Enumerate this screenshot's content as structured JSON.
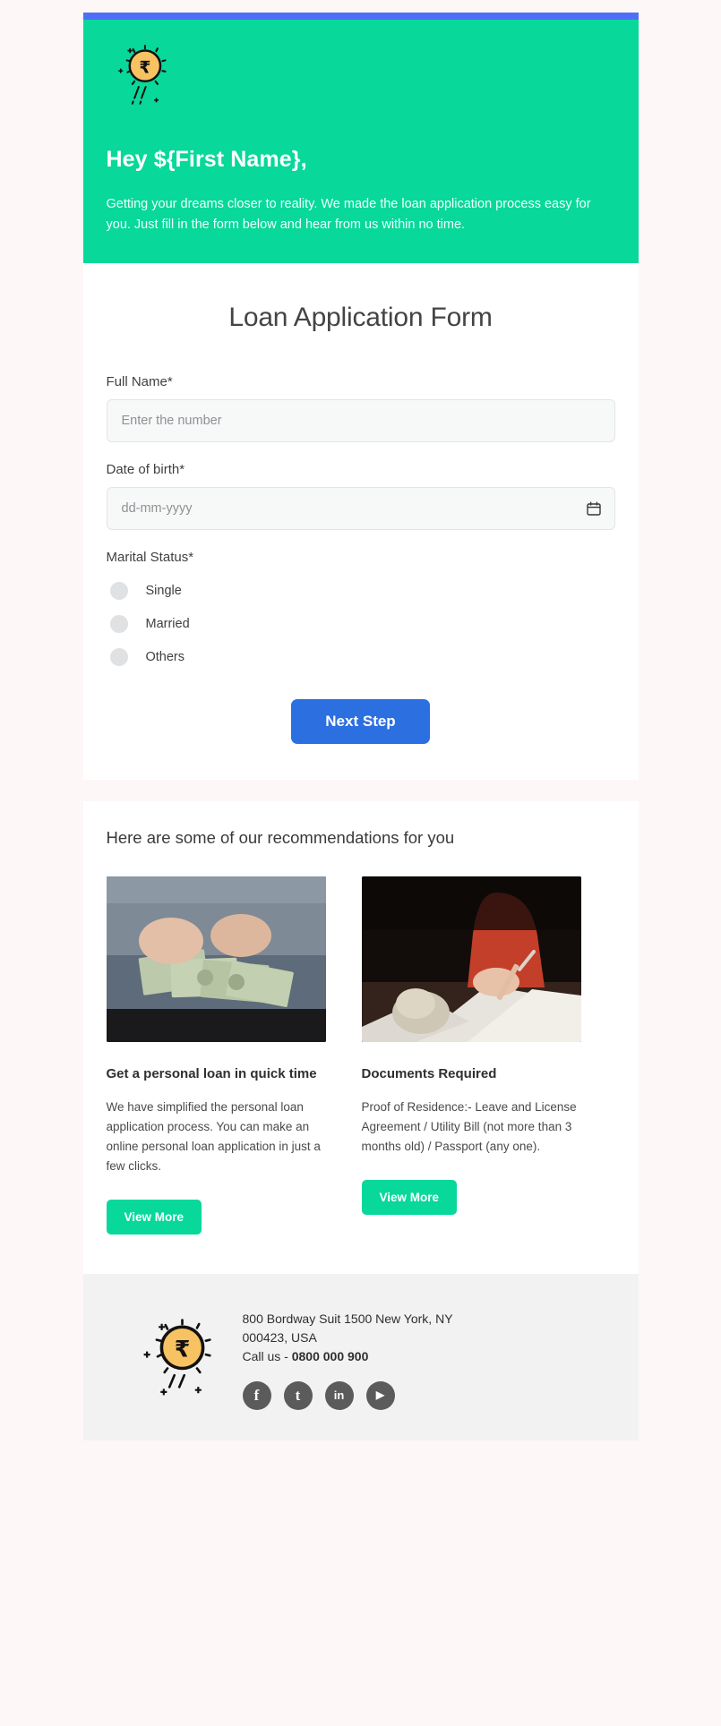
{
  "theme": {
    "accent_bar": "#4f6ef7",
    "brand_green": "#08d89a",
    "primary_blue": "#2b6fe0",
    "page_bg": "#fdf7f7",
    "footer_bg": "#f2f2f2"
  },
  "hero": {
    "logo_icon": "rupee-coin-icon",
    "title": "Hey ${First Name},",
    "subtitle": "Getting your dreams closer to reality. We made the loan application process easy for you. Just fill in the form below and hear from us within no time."
  },
  "form": {
    "title": "Loan Application Form",
    "fields": [
      {
        "label": "Full Name*",
        "placeholder": "Enter the number",
        "value": "",
        "type": "text"
      },
      {
        "label": "Date of birth*",
        "placeholder": "dd-mm-yyyy",
        "value": "",
        "type": "date",
        "icon": "calendar-icon"
      }
    ],
    "marital": {
      "label": "Marital Status*",
      "options": [
        "Single",
        "Married",
        "Others"
      ]
    },
    "submit_label": "Next Step"
  },
  "recommendations": {
    "heading": "Here are some of our recommendations for you",
    "cards": [
      {
        "image_alt": "hands-holding-cash-photo",
        "title": "Get a personal loan in quick time",
        "body": "We have simplified the personal loan application process. You can make an online personal loan application in just a few clicks.",
        "button_label": "View More"
      },
      {
        "image_alt": "person-signing-documents-photo",
        "title": "Documents Required",
        "body": "Proof of Residence:- Leave and License Agreement / Utility Bill (not more than 3 months old) / Passport (any one).",
        "button_label": "View More"
      }
    ]
  },
  "footer": {
    "logo_icon": "rupee-coin-icon",
    "address": "800 Bordway Suit 1500 New York, NY 000423, USA",
    "call_prefix": "Call us - ",
    "phone": "0800 000 900",
    "social": [
      {
        "name": "facebook-icon",
        "glyph": "f"
      },
      {
        "name": "tumblr-icon",
        "glyph": "t"
      },
      {
        "name": "linkedin-icon",
        "glyph": "in"
      },
      {
        "name": "youtube-icon",
        "glyph": "▶"
      }
    ]
  }
}
